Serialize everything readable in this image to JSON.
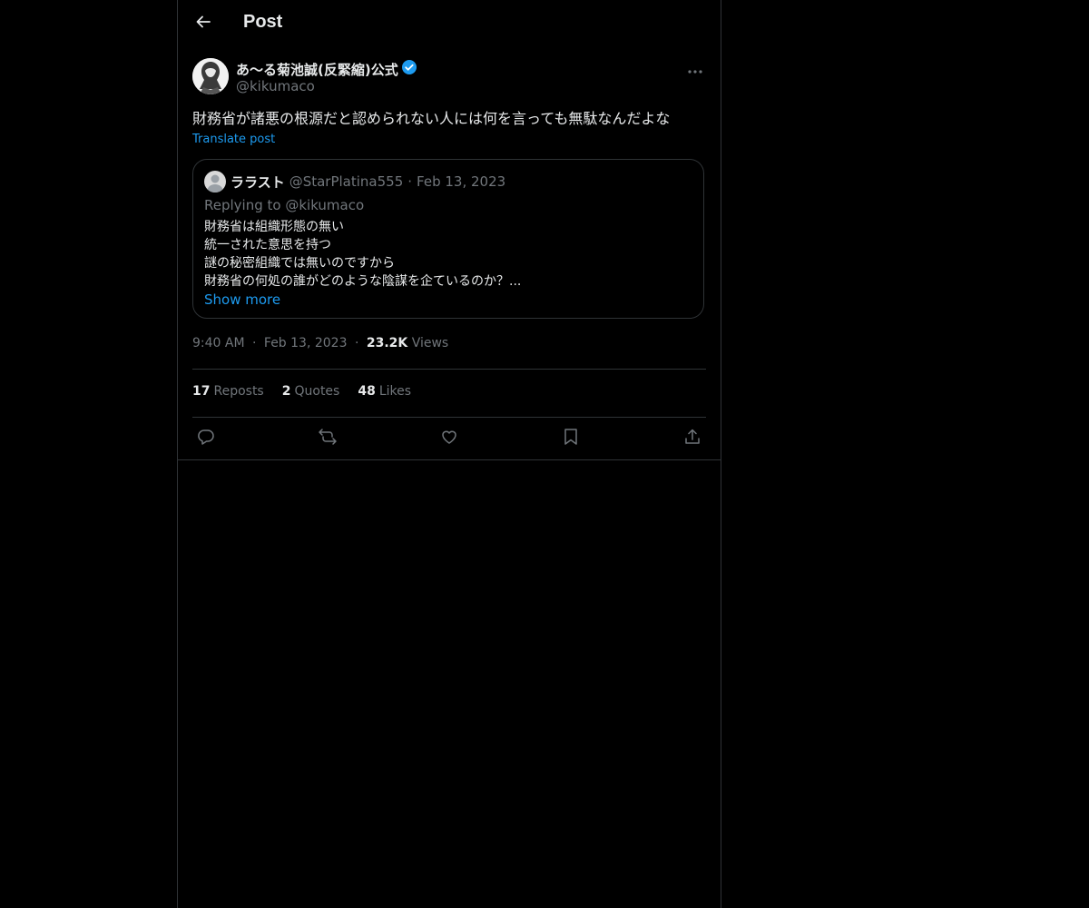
{
  "header": {
    "title": "Post",
    "back_icon": "arrow-left-icon"
  },
  "post": {
    "author_name": "あ〜る菊池誠(反緊縮)公式",
    "verified_icon": "verified-badge-icon",
    "handle": "@kikumaco",
    "text": "財務省が諸悪の根源だと認められない人には何を言っても無駄なんだよな",
    "translate_label": "Translate post",
    "quote": {
      "name": "ララスト",
      "handle": "@StarPlatina555",
      "separator": "·",
      "date": "Feb 13, 2023",
      "replying_to": "Replying to @kikumaco",
      "lines": [
        "財務省は組織形態の無い",
        "統一された意思を持つ",
        "謎の秘密組織では無いのですから",
        "財務省の何処の誰がどのような陰謀を企ているのか？..."
      ],
      "show_more": "Show more"
    },
    "time": "9:40 AM",
    "date": "Feb 13, 2023",
    "separator": "·",
    "views_count": "23.2K",
    "views_label": "Views",
    "stats": {
      "reposts_count": "17",
      "reposts_label": "Reposts",
      "quotes_count": "2",
      "quotes_label": "Quotes",
      "likes_count": "48",
      "likes_label": "Likes"
    },
    "actions": [
      "reply-icon",
      "repost-icon",
      "like-icon",
      "bookmark-icon",
      "share-icon"
    ]
  },
  "colors": {
    "background": "#000000",
    "text": "#e7e9ea",
    "muted": "#71767b",
    "accent": "#1d9bf0",
    "border": "#2f3336"
  }
}
